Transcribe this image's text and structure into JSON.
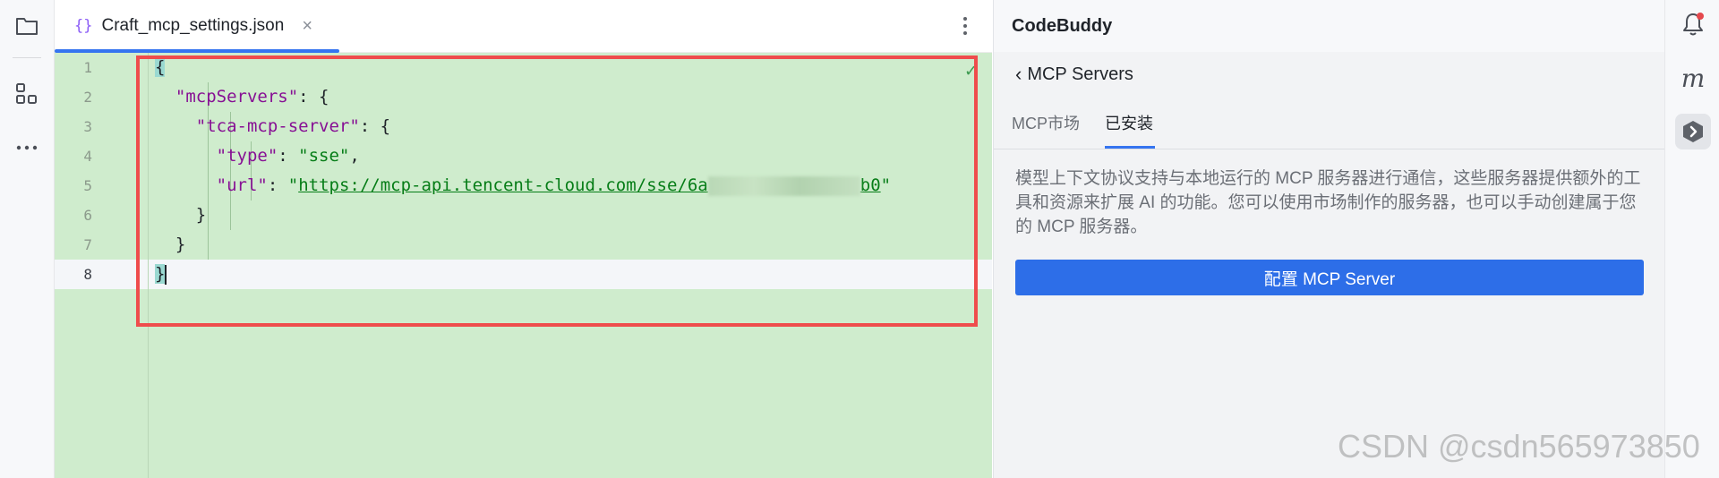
{
  "editor": {
    "tab": {
      "icon": "{}",
      "title": "Craft_mcp_settings.json",
      "close": "×"
    },
    "line_numbers": [
      "1",
      "2",
      "3",
      "4",
      "5",
      "6",
      "7",
      "8"
    ],
    "code": {
      "l1_brace": "{",
      "l2_key": "\"mcpServers\"",
      "l2_rest": ": {",
      "l3_key": "\"tca-mcp-server\"",
      "l3_rest": ": {",
      "l4_key": "\"type\"",
      "l4_colon": ": ",
      "l4_val": "\"sse\"",
      "l4_comma": ",",
      "l5_key": "\"url\"",
      "l5_colon": ": ",
      "l5_quote_open": "\"",
      "l5_url_visible": "https://mcp-api.tencent-cloud.com/sse/6a",
      "l5_url_tail": "b0",
      "l5_quote_close": "\"",
      "l6": "}",
      "l7": "}",
      "l8": "}"
    },
    "check_glyph": "✓"
  },
  "panel": {
    "title": "CodeBuddy",
    "back_label": "MCP Servers",
    "tabs": [
      {
        "label": "MCP市场",
        "active": false
      },
      {
        "label": "已安装",
        "active": true
      }
    ],
    "description": "模型上下文协议支持与本地运行的 MCP 服务器进行通信，这些服务器提供额外的工具和资源来扩展 AI 的功能。您可以使用市场制作的服务器，也可以手动创建属于您的 MCP 服务器。",
    "configure_button": "配置 MCP Server"
  },
  "watermark": "CSDN @csdn565973850",
  "colors": {
    "accent": "#3574f0",
    "button": "#2d6ee8",
    "diff_background": "#cfeccd",
    "highlight_box": "#ef4c4c"
  },
  "icons": {
    "left": [
      "folder-icon",
      "structure-icon",
      "more-icon"
    ],
    "right": [
      "bell-icon",
      "m-plugin-icon",
      "codebuddy-icon"
    ]
  }
}
